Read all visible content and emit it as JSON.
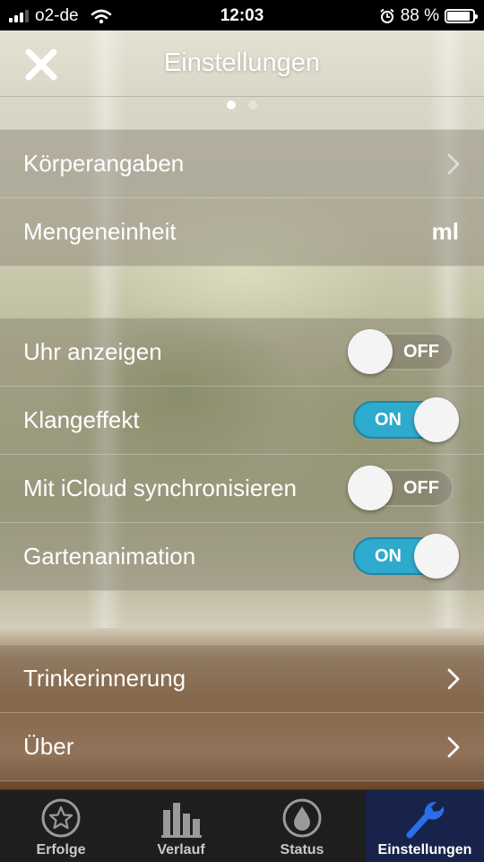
{
  "status_bar": {
    "carrier": "o2-de",
    "time": "12:03",
    "battery": "88 %",
    "battery_level": 0.88,
    "signal_icon": "signal-icon",
    "wifi_icon": "wifi-icon",
    "alarm_icon": "alarm-icon"
  },
  "header": {
    "title": "Einstellungen",
    "close_icon": "close-icon"
  },
  "page_indicator": {
    "pages": 2,
    "current": 1
  },
  "sections": {
    "body": {
      "items": [
        {
          "label": "Körperangaben",
          "type": "link"
        },
        {
          "label": "Mengeneinheit",
          "value": "ml"
        }
      ]
    },
    "toggles": {
      "items": [
        {
          "label": "Uhr anzeigen",
          "state": "OFF"
        },
        {
          "label": "Klangeffekt",
          "state": "ON"
        },
        {
          "label": "Mit iCloud synchronisieren",
          "state": "OFF"
        },
        {
          "label": "Gartenanimation",
          "state": "ON"
        }
      ]
    },
    "more": {
      "items": [
        {
          "label": "Trinkerinnerung",
          "type": "link"
        },
        {
          "label": "Über",
          "type": "link"
        }
      ]
    }
  },
  "tab_bar": {
    "tabs": [
      {
        "label": "Erfolge",
        "icon": "star-icon"
      },
      {
        "label": "Verlauf",
        "icon": "bar-chart-icon"
      },
      {
        "label": "Status",
        "icon": "water-drop-icon"
      },
      {
        "label": "Einstellungen",
        "icon": "wrench-icon",
        "active": true
      }
    ]
  },
  "colors": {
    "toggle_on": "#2eaacd",
    "tab_active_bg": "#17234a",
    "wrench_icon": "#2a6ee8"
  }
}
